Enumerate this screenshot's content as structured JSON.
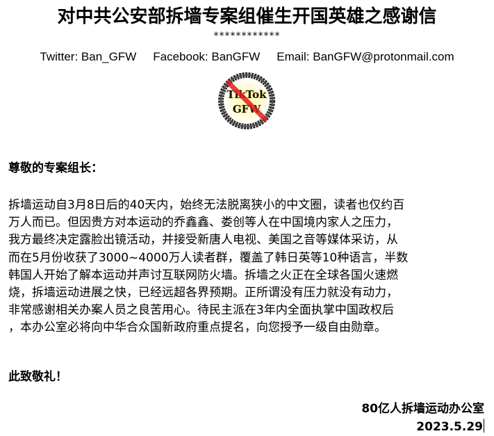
{
  "document": {
    "title": "对中共公安部拆墙专案组催生开国英雄之感谢信",
    "separator": "************",
    "contacts": {
      "twitter": "Twitter: Ban_GFW",
      "facebook": "Facebook: BanGFW",
      "email": "Email: BanGFW@protonmail.com"
    },
    "logo": {
      "icon": "no-tiktok-icon",
      "line1": "TikTok",
      "line2": "GFW",
      "colors": {
        "ring": "#2b2b2b",
        "slash": "#e02020",
        "glow": "#f2d400"
      }
    },
    "salutation": "尊敬的专案组长：",
    "body_lines": [
      "拆墙运动自3月8日后的40天内，始终无法脱离狭小的中文圈，读者也仅约百",
      "万人而已。但因贵方对本运动的乔鑫鑫、娄创等人在中国境内家人之压力，",
      "我方最终决定露脸出镜活动，并接受新唐人电视、美国之音等媒体采访，从",
      "而在5月份收获了3000~4000万人读者群，覆盖了韩日英等10种语言，半数",
      "韩国人开始了解本运动并声讨互联网防火墙。拆墙之火正在全球各国火速燃",
      "烧，拆墙运动进展之快，已经远超各界预期。正所谓没有压力就没有动力，",
      "非常感谢相关办案人员之良苦用心。待民主派在3年内全面执掌中国政权后",
      "，本办公室必将向中华合众国新政府重点提名，向您授予一级自由勋章。"
    ],
    "closing": "此致敬礼！",
    "signature": {
      "organization": "80亿人拆墙运动办公室",
      "date": "2023.5.29"
    }
  }
}
